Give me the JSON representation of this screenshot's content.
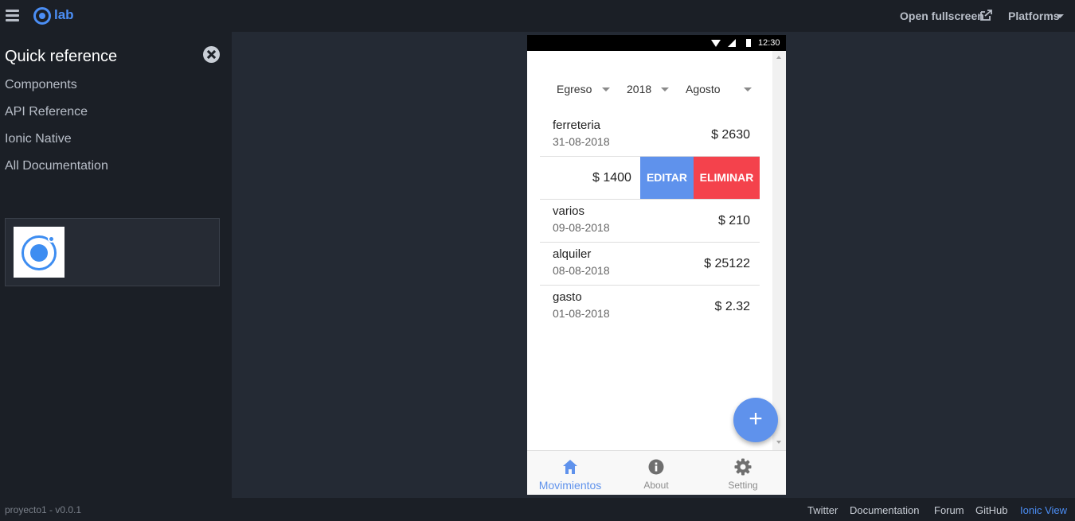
{
  "topbar": {
    "logo_text": "lab",
    "open_fullscreen": "Open fullscreen",
    "platforms": "Platforms"
  },
  "sidebar": {
    "title": "Quick reference",
    "links": [
      "Components",
      "API Reference",
      "Ionic Native",
      "All Documentation"
    ]
  },
  "footer": {
    "version": "proyecto1 - v0.0.1",
    "links": [
      "Twitter",
      "Documentation",
      "Forum",
      "GitHub",
      "Ionic View"
    ]
  },
  "phone": {
    "status_time": "12:30",
    "filters": {
      "type": "Egreso",
      "year": "2018",
      "month": "Agosto"
    },
    "items": [
      {
        "name": "ferreteria",
        "date": "31-08-2018",
        "amount": "$ 2630"
      },
      {
        "name": "varios",
        "date": "09-08-2018",
        "amount": "$ 210"
      },
      {
        "name": "alquiler",
        "date": "08-08-2018",
        "amount": "$ 25122"
      },
      {
        "name": "gasto",
        "date": "01-08-2018",
        "amount": "$ 2.32"
      }
    ],
    "swiped_item": {
      "amount": "$ 1400",
      "edit_label": "EDITAR",
      "delete_label": "ELIMINAR"
    },
    "fab_label": "+",
    "tabs": [
      {
        "label": "Movimientos",
        "icon": "home-icon",
        "active": true
      },
      {
        "label": "About",
        "icon": "info-icon",
        "active": false
      },
      {
        "label": "Setting",
        "icon": "gear-icon",
        "active": false
      }
    ]
  },
  "colors": {
    "accent": "#4b8ef5",
    "edit": "#5f92ec",
    "delete": "#f4424c"
  }
}
